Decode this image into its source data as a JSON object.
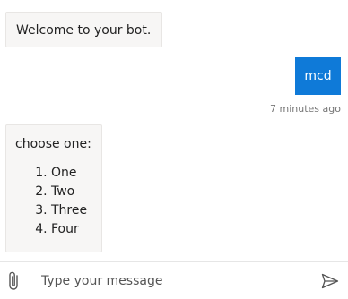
{
  "messages": {
    "welcome": "Welcome to your bot.",
    "user": "mcd",
    "timestamp": "7 minutes ago",
    "prompt": "choose one:",
    "choices": [
      "One",
      "Two",
      "Three",
      "Four"
    ]
  },
  "sendbox": {
    "placeholder": "Type your message"
  },
  "colors": {
    "user_bubble": "#0f7ad8",
    "bot_bubble": "#f7f6f5"
  }
}
